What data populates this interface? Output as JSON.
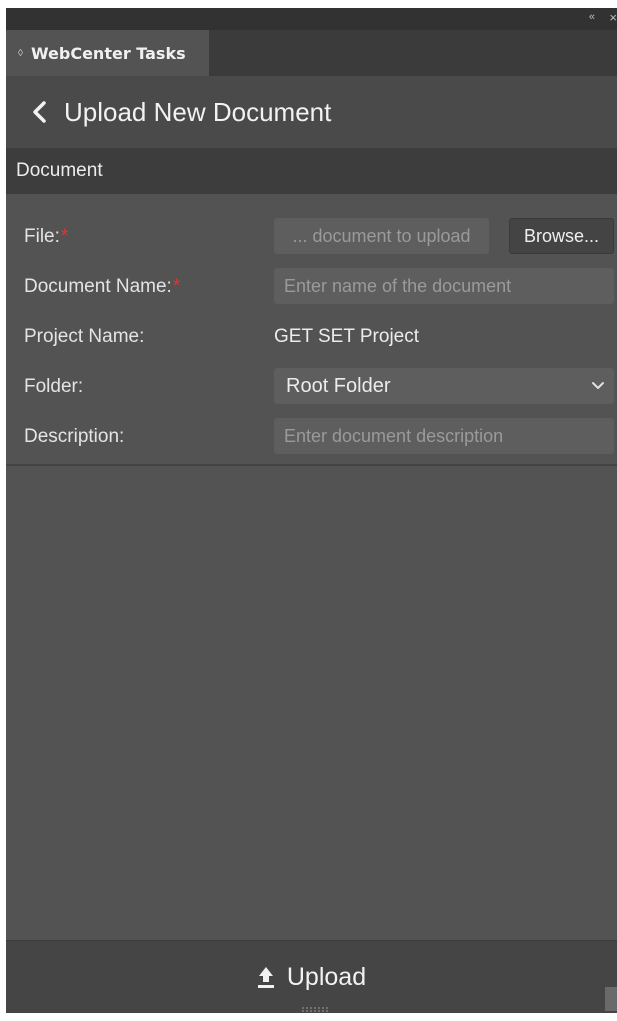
{
  "window": {
    "collapse_glyph": "«",
    "close_glyph": "×"
  },
  "tab": {
    "icon_glyph": "◊",
    "label": "WebCenter Tasks"
  },
  "header": {
    "title": "Upload New Document",
    "back_icon": "chevron-left-icon"
  },
  "section": {
    "title": "Document"
  },
  "form": {
    "required_mark": "*",
    "file": {
      "label": "File:",
      "placeholder": "... document to upload",
      "browse_label": "Browse..."
    },
    "document_name": {
      "label": "Document Name:",
      "placeholder": "Enter name of the document"
    },
    "project_name": {
      "label": "Project Name:",
      "value": "GET SET Project"
    },
    "folder": {
      "label": "Folder:",
      "selected": "Root Folder"
    },
    "description": {
      "label": "Description:",
      "placeholder": "Enter document description"
    }
  },
  "footer": {
    "upload_label": "Upload",
    "upload_icon": "upload-icon"
  },
  "colors": {
    "panel_bg": "#535353",
    "header_bg": "#4a4a4a",
    "section_bg": "#3d3d3d",
    "field_bg": "#5e5e5e",
    "required": "#e0352f"
  }
}
